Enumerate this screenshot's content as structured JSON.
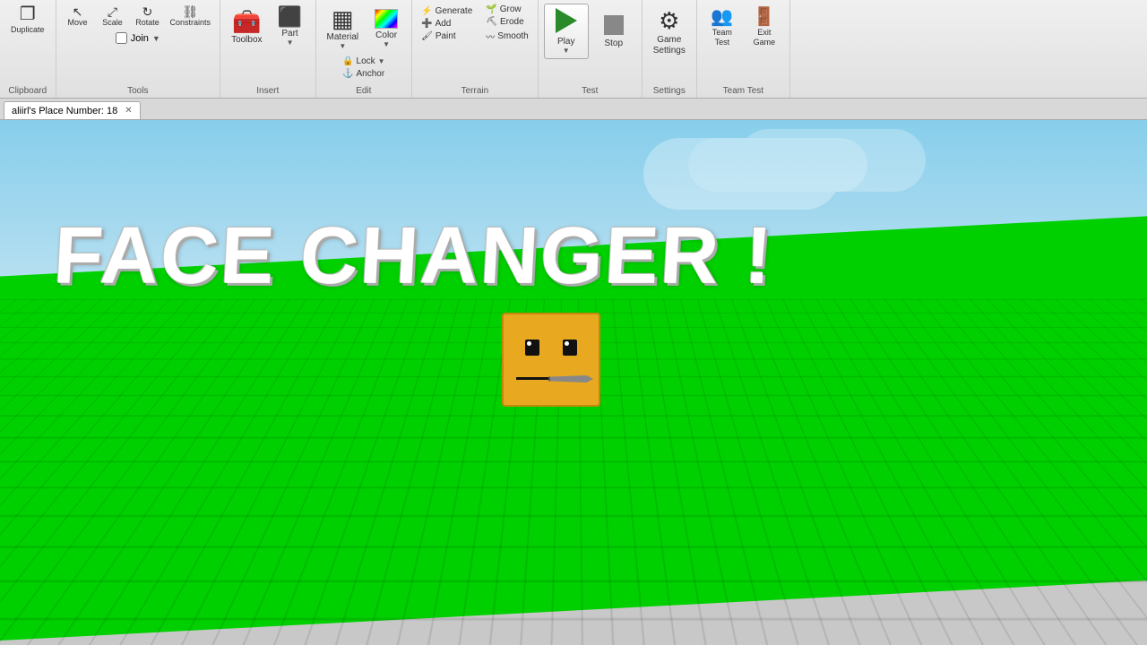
{
  "toolbar": {
    "sections": {
      "clipboard": {
        "label": "Clipboard",
        "duplicate_label": "Duplicate"
      },
      "tools": {
        "label": "Tools",
        "move_label": "Move",
        "scale_label": "Scale",
        "rotate_label": "Rotate",
        "constraints_label": "Constraints",
        "join_label": "Join"
      },
      "insert": {
        "label": "Insert",
        "toolbox_label": "Toolbox",
        "part_label": "Part"
      },
      "edit": {
        "label": "Edit",
        "material_label": "Material",
        "color_label": "Color",
        "lock_label": "Lock",
        "anchor_label": "Anchor"
      },
      "terrain": {
        "label": "Terrain",
        "generate_label": "Generate",
        "add_label": "Add",
        "paint_label": "Paint",
        "grow_label": "Grow",
        "erode_label": "Erode",
        "smooth_label": "Smooth"
      },
      "test": {
        "label": "Test",
        "play_label": "Play",
        "stop_label": "Stop"
      },
      "settings": {
        "label": "Settings",
        "game_settings_label": "Game Settings"
      },
      "team_test": {
        "label": "Team Test",
        "team_test_label": "Team Test",
        "exit_game_label": "Exit Game"
      }
    }
  },
  "tabbar": {
    "tab_label": "aliirl's Place Number: 18"
  },
  "viewport": {
    "title_line1": "FACE CHANGER !"
  },
  "icons": {
    "duplicate": "❐",
    "move": "✥",
    "scale": "⊞",
    "rotate": "↻",
    "toolbox": "🧰",
    "part": "⬛",
    "material": "▦",
    "color": "🎨",
    "lock": "🔒",
    "anchor": "⚓",
    "generate": "⚡",
    "add": "➕",
    "paint": "🖌",
    "grow": "🌱",
    "erode": "⛏",
    "smooth": "〰",
    "gear": "⚙",
    "team": "👥",
    "exit": "🚪"
  }
}
